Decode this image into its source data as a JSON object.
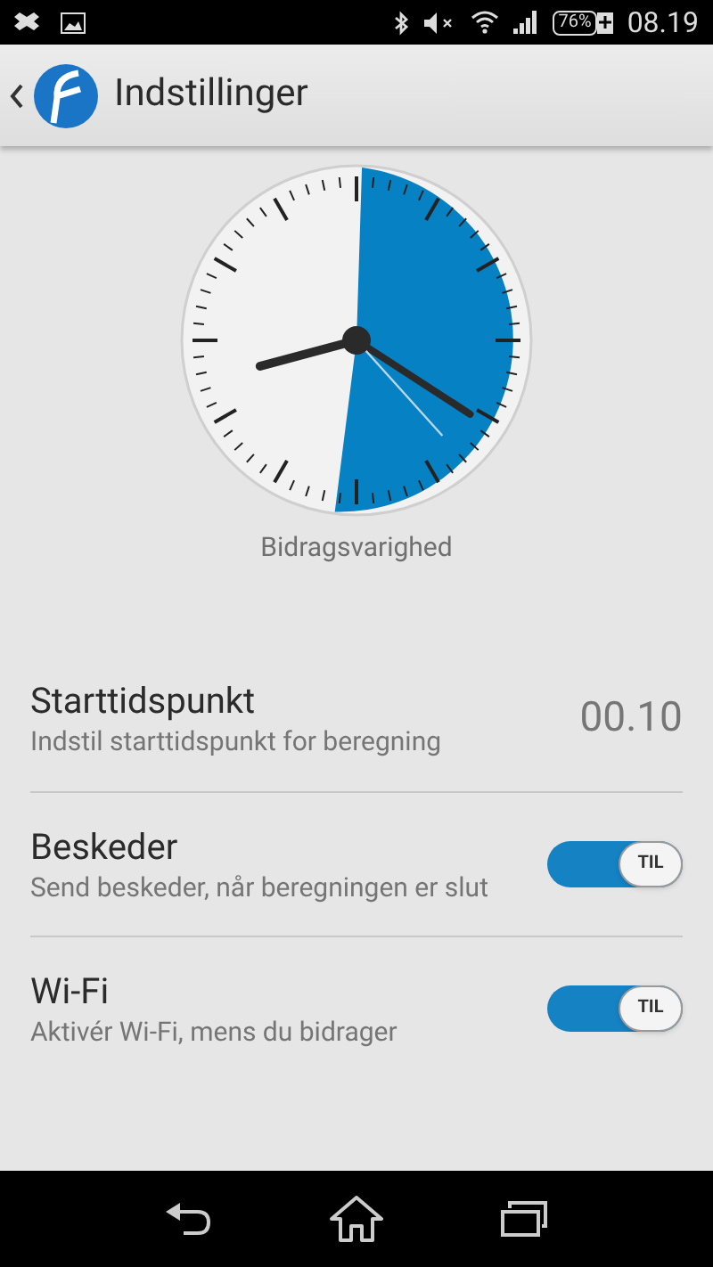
{
  "status_bar": {
    "battery": "76%",
    "time": "08.19"
  },
  "action_bar": {
    "title": "Indstillinger"
  },
  "clock": {
    "caption": "Bidragsvarighed"
  },
  "settings": [
    {
      "kind": "value",
      "title": "Starttidspunkt",
      "subtitle": "Indstil starttidspunkt for beregning",
      "value": "00.10"
    },
    {
      "kind": "toggle",
      "title": "Beskeder",
      "subtitle": "Send beskeder, når beregningen er slut",
      "on": true,
      "toggle_label": "TIL"
    },
    {
      "kind": "toggle",
      "title": "Wi-Fi",
      "subtitle": "Aktivér Wi-Fi, mens du bidrager",
      "on": true,
      "toggle_label": "TIL"
    }
  ]
}
